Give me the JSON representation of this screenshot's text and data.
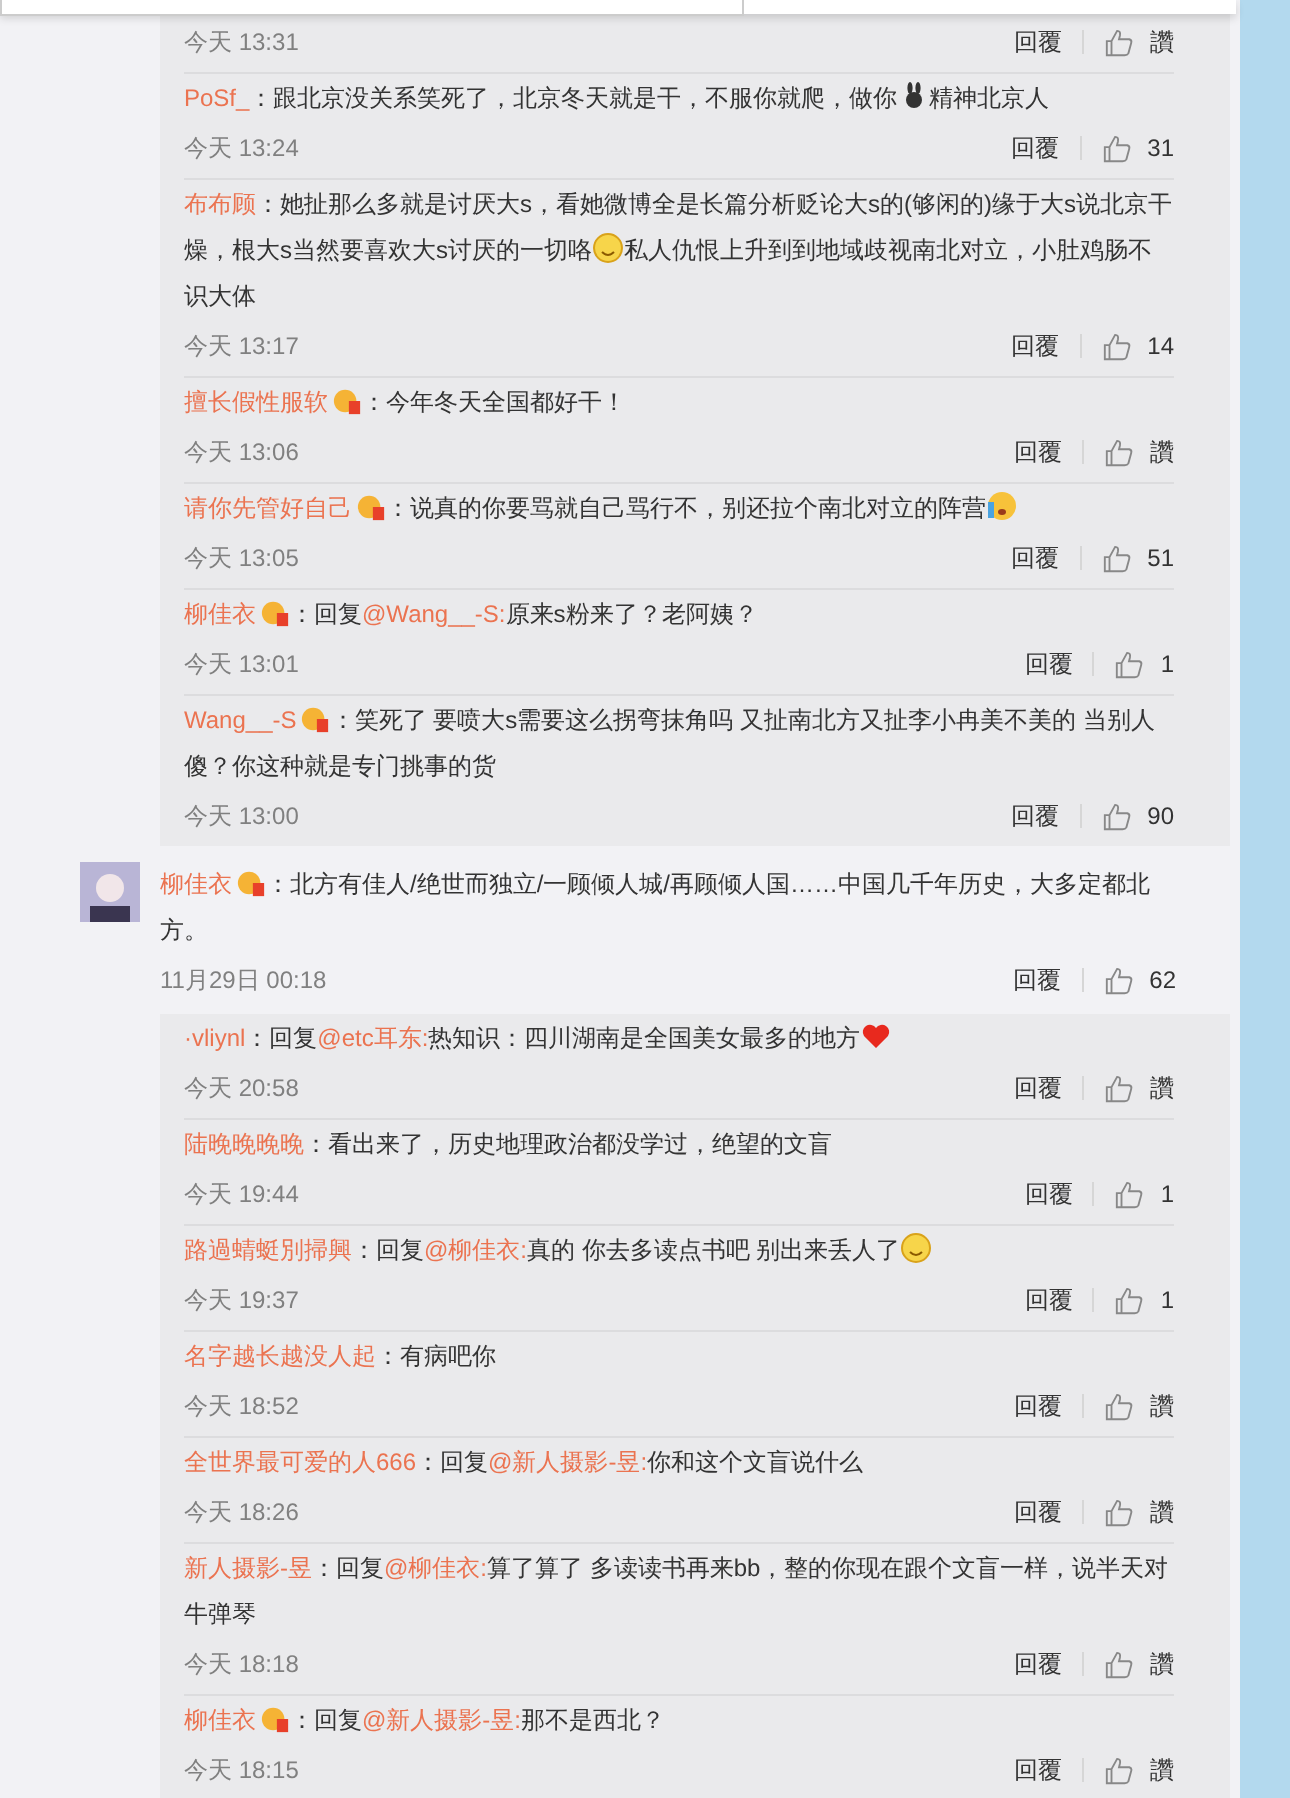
{
  "groups_before": [
    {
      "time": "今天 13:31",
      "reply": "回覆",
      "like": "讚"
    },
    {
      "user": "PoSf_",
      "badge": false,
      "text": "：跟北京没关系笑死了，北京冬天就是干，不服你就爬，做你",
      "emoji": {
        "kind": "rabbit"
      },
      "text_after": "精神北京人",
      "time": "今天 13:24",
      "reply": "回覆",
      "like": "31"
    },
    {
      "user": "布布顾",
      "badge": false,
      "text": "：她扯那么多就是讨厌大s，看她微博全是长篇分析贬论大s的(够闲的)缘于大s说北京干燥，根大s当然要喜欢大s讨厌的一切咯",
      "emoji": {
        "kind": "smile"
      },
      "text_after": "私人仇恨上升到到地域歧视南北对立，小肚鸡肠不识大体",
      "time": "今天 13:17",
      "reply": "回覆",
      "like": "14"
    },
    {
      "user": "擅长假性服软",
      "badge": true,
      "text": "：今年冬天全国都好干！",
      "time": "今天 13:06",
      "reply": "回覆",
      "like": "讚"
    },
    {
      "user": "请你先管好自己",
      "badge": true,
      "text": "：说真的你要骂就自己骂行不，别还拉个南北对立的阵营",
      "emoji": {
        "kind": "crying"
      },
      "time": "今天 13:05",
      "reply": "回覆",
      "like": "51"
    },
    {
      "user": "柳佳衣",
      "badge": true,
      "prefix": "：回复",
      "mention": "@Wang__-S:",
      "text": "原来s粉来了？老阿姨？",
      "time": "今天 13:01",
      "reply": "回覆",
      "like": "1"
    },
    {
      "user": "Wang__-S",
      "badge": true,
      "text": "：笑死了 要喷大s需要这么拐弯抹角吗 又扯南北方又扯李小冉美不美的 当别人傻？你这种就是专门挑事的货",
      "time": "今天 13:00",
      "reply": "回覆",
      "like": "90"
    }
  ],
  "comment": {
    "user": "柳佳衣",
    "badge": true,
    "text": "：北方有佳人/绝世而独立/一顾倾人城/再顾倾人国……中国几千年历史，大多定都北方。",
    "time": "11月29日 00:18",
    "reply": "回覆",
    "like": "62"
  },
  "replies": [
    {
      "user": "·vliynl",
      "badge": false,
      "prefix": "：回复",
      "mention": "@etc耳东:",
      "text": "热知识：四川湖南是全国美女最多的地方",
      "emoji": {
        "kind": "heart"
      },
      "time": "今天 20:58",
      "reply": "回覆",
      "like": "讚"
    },
    {
      "user": "陆晚晚晚晚",
      "badge": false,
      "text": "：看出来了，历史地理政治都没学过，绝望的文盲",
      "time": "今天 19:44",
      "reply": "回覆",
      "like": "1"
    },
    {
      "user": "路過蜻蜓別掃興",
      "badge": false,
      "prefix": "：回复",
      "mention": "@柳佳衣:",
      "text": "真的 你去多读点书吧 别出来丢人了",
      "emoji": {
        "kind": "smile"
      },
      "time": "今天 19:37",
      "reply": "回覆",
      "like": "1"
    },
    {
      "user": "名字越长越没人起",
      "badge": false,
      "text": "：有病吧你",
      "time": "今天 18:52",
      "reply": "回覆",
      "like": "讚"
    },
    {
      "user": "全世界最可爱的人666",
      "badge": false,
      "prefix": "：回复",
      "mention": "@新人摄影-昱:",
      "text": "你和这个文盲说什么",
      "time": "今天 18:26",
      "reply": "回覆",
      "like": "讚"
    },
    {
      "user": "新人摄影-昱",
      "badge": false,
      "prefix": "：回复",
      "mention": "@柳佳衣:",
      "text": "算了算了 多读读书再来bb，整的你现在跟个文盲一样，说半天对牛弹琴",
      "time": "今天 18:18",
      "reply": "回覆",
      "like": "讚"
    },
    {
      "user": "柳佳衣",
      "badge": true,
      "prefix": "：回复",
      "mention": "@新人摄影-昱:",
      "text": "那不是西北？",
      "time": "今天 18:15",
      "reply": "回覆",
      "like": "讚"
    }
  ]
}
